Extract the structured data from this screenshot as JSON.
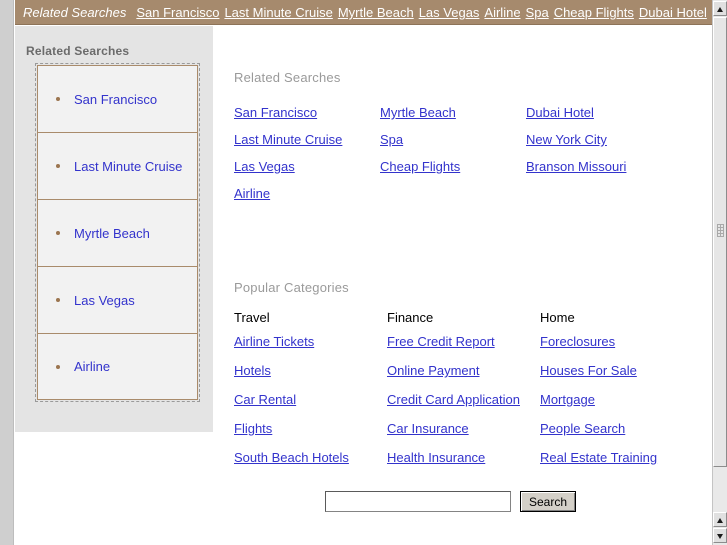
{
  "topbar": {
    "title": "Related Searches",
    "links": [
      "San Francisco",
      "Last Minute Cruise",
      "Myrtle Beach",
      "Las Vegas",
      "Airline",
      "Spa",
      "Cheap Flights",
      "Dubai Hotel"
    ],
    "background_color": "#a68a6d",
    "link_color": "#ffffff"
  },
  "sidebar": {
    "heading": "Related Searches",
    "items": [
      {
        "label": "San Francisco"
      },
      {
        "label": "Last Minute Cruise"
      },
      {
        "label": "Myrtle Beach"
      },
      {
        "label": "Las Vegas"
      },
      {
        "label": "Airline"
      }
    ],
    "bullet_color": "#9b7550",
    "background_color": "#e4e4e4",
    "link_color": "#3333cc"
  },
  "main": {
    "related_searches": {
      "heading": "Related Searches",
      "columns": [
        {
          "links": [
            "San Francisco",
            "Last Minute Cruise",
            "Las Vegas",
            "Airline"
          ]
        },
        {
          "links": [
            "Myrtle Beach",
            "Spa",
            "Cheap Flights"
          ]
        },
        {
          "links": [
            "Dubai Hotel",
            "New York City",
            "Branson Missouri"
          ]
        }
      ]
    },
    "popular_categories": {
      "heading": "Popular Categories",
      "columns": [
        {
          "title": "Travel",
          "links": [
            "Airline Tickets",
            "Hotels",
            "Car Rental",
            "Flights",
            "South Beach Hotels"
          ]
        },
        {
          "title": "Finance",
          "links": [
            "Free Credit Report",
            "Online Payment",
            "Credit Card Application",
            "Car Insurance",
            "Health Insurance"
          ]
        },
        {
          "title": "Home",
          "links": [
            "Foreclosures",
            "Houses For Sale",
            "Mortgage",
            "People Search",
            "Real Estate Training"
          ]
        }
      ]
    },
    "search": {
      "value": "",
      "placeholder": "",
      "button_label": "Search"
    },
    "link_color": "#3333cc",
    "heading_color": "#9a9a9a"
  },
  "scrollbar": {
    "up_icon": "scroll-up-arrow",
    "down_icon": "scroll-down-arrow"
  }
}
